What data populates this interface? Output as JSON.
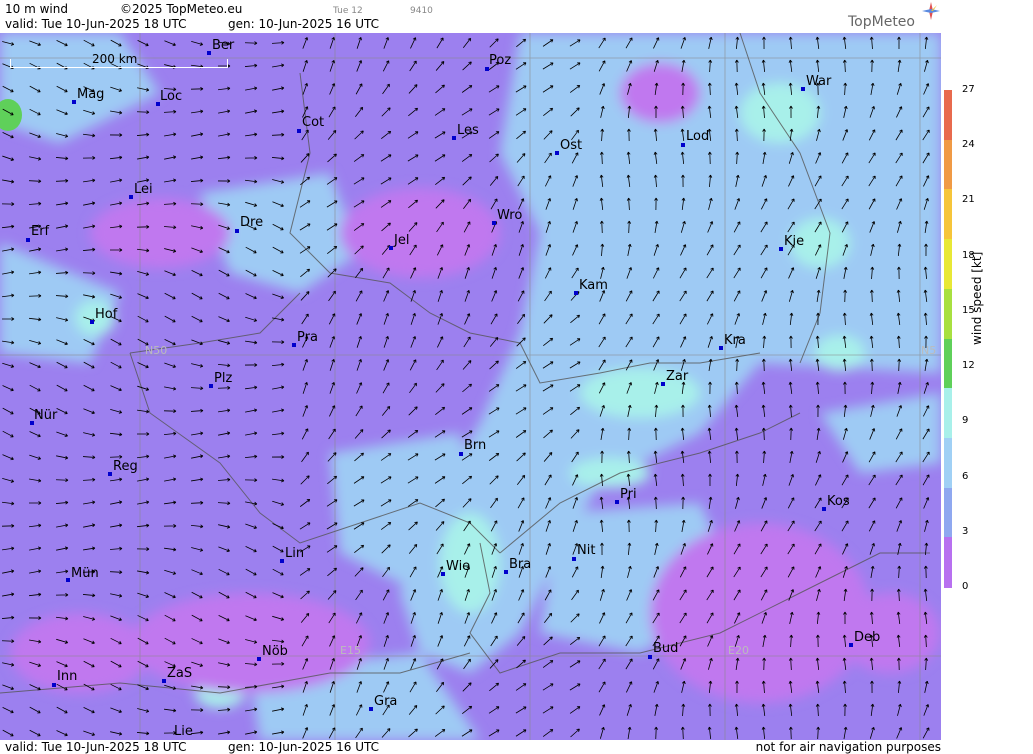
{
  "header": {
    "parameter": "10 m wind",
    "copyright": "©2025 TopMeteo.eu",
    "tab_center": "Tue 12",
    "tab_id": "9410",
    "valid": "valid:  Tue  10-Jun-2025  18 UTC",
    "gen": "gen: 10-Jun-2025 16 UTC",
    "logo": "TopMeteo"
  },
  "footer": {
    "valid": "valid:  Tue  10-Jun-2025  18 UTC",
    "gen": "gen: 10-Jun-2025 16 UTC",
    "note": "not for air navigation purposes"
  },
  "scale_bar": "200 km",
  "grid_labels": {
    "n50_left": "N50",
    "n50_right": "N5",
    "e15": "E15",
    "e20": "E20"
  },
  "cities": [
    "Ber",
    "Poz",
    "War",
    "Mag",
    "Loc",
    "Cot",
    "Les",
    "Lod",
    "Ost",
    "Lei",
    "Erf",
    "Dre",
    "Wro",
    "Jel",
    "Kie",
    "Kam",
    "Hof",
    "Pra",
    "Kra",
    "Plz",
    "Zar",
    "Nür",
    "Brn",
    "Reg",
    "Pri",
    "Kos",
    "Lin",
    "Nit",
    "Wie",
    "Bra",
    "Mün",
    "Deb",
    "Nöb",
    "E15",
    "Bud",
    "Inn",
    "ZaS",
    "Gra",
    "Lie"
  ],
  "legend": {
    "title": "wind speed [kt]",
    "ticks": [
      "27",
      "24",
      "21",
      "18",
      "15",
      "12",
      "9",
      "6",
      "3",
      "0"
    ],
    "colors": [
      "#e86a4e",
      "#f09a45",
      "#f6c53a",
      "#e8e836",
      "#a8e040",
      "#5fd05a",
      "#a8f0ea",
      "#a0d0f5",
      "#8fa8f0",
      "#b870f0"
    ]
  }
}
